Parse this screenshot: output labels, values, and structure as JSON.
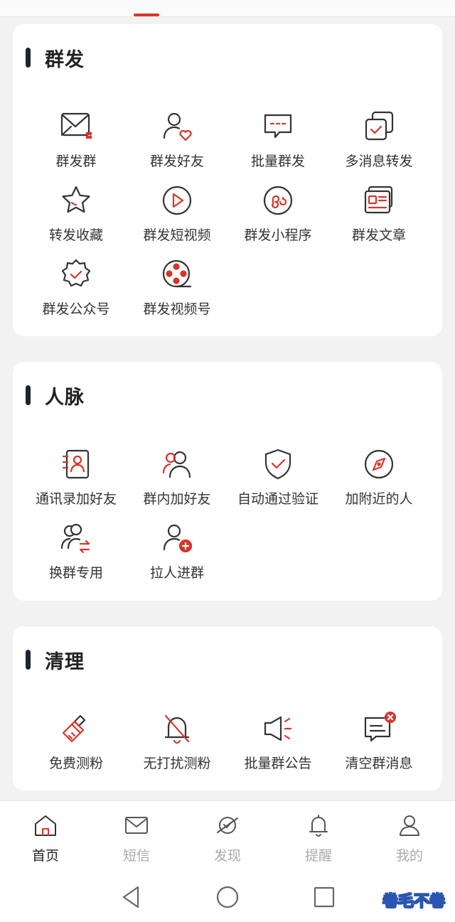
{
  "colors": {
    "accent": "#d9342b",
    "dark": "#333333",
    "tab_inactive": "#aaaaaa"
  },
  "sections": [
    {
      "title": "群发",
      "items": [
        {
          "label": "群发群",
          "icon": "mail-group-icon"
        },
        {
          "label": "群发好友",
          "icon": "user-heart-icon"
        },
        {
          "label": "批量群发",
          "icon": "chat-bubble-icon"
        },
        {
          "label": "多消息转发",
          "icon": "multi-check-icon"
        },
        {
          "label": "转发收藏",
          "icon": "star-icon"
        },
        {
          "label": "群发短视频",
          "icon": "play-circle-icon"
        },
        {
          "label": "群发小程序",
          "icon": "mini-program-icon"
        },
        {
          "label": "群发文章",
          "icon": "article-card-icon"
        },
        {
          "label": "群发公众号",
          "icon": "badge-check-icon"
        },
        {
          "label": "群发视频号",
          "icon": "film-reel-icon"
        }
      ]
    },
    {
      "title": "人脉",
      "items": [
        {
          "label": "通讯录加好友",
          "icon": "contact-book-icon"
        },
        {
          "label": "群内加好友",
          "icon": "group-users-icon"
        },
        {
          "label": "自动通过验证",
          "icon": "shield-check-icon"
        },
        {
          "label": "加附近的人",
          "icon": "compass-icon"
        },
        {
          "label": "换群专用",
          "icon": "users-swap-icon"
        },
        {
          "label": "拉人进群",
          "icon": "user-add-icon"
        }
      ]
    },
    {
      "title": "清理",
      "items": [
        {
          "label": "免费测粉",
          "icon": "brush-icon"
        },
        {
          "label": "无打扰测粉",
          "icon": "bell-off-icon"
        },
        {
          "label": "批量群公告",
          "icon": "megaphone-icon"
        },
        {
          "label": "清空群消息",
          "icon": "message-clear-icon"
        }
      ]
    }
  ],
  "tabbar": [
    {
      "label": "首页",
      "icon": "home-icon",
      "active": true
    },
    {
      "label": "短信",
      "icon": "mail-icon",
      "active": false
    },
    {
      "label": "发现",
      "icon": "planet-icon",
      "active": false
    },
    {
      "label": "提醒",
      "icon": "bell-icon",
      "active": false
    },
    {
      "label": "我的",
      "icon": "user-icon",
      "active": false
    }
  ],
  "watermark": "卷毛不卷"
}
